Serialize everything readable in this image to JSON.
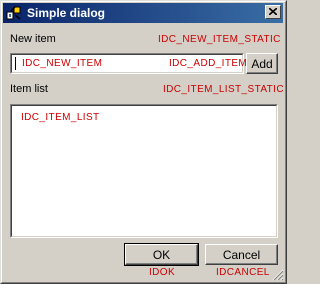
{
  "window": {
    "title": "Simple dialog"
  },
  "new_item": {
    "label": "New item",
    "id_label": "IDC_NEW_ITEM_STATIC"
  },
  "edit": {
    "id_label": "IDC_NEW_ITEM",
    "value": ""
  },
  "add_button": {
    "id_label": "IDC_ADD_ITEM",
    "label": "Add"
  },
  "item_list": {
    "label": "Item list",
    "id_label": "IDC_ITEM_LIST_STATIC",
    "list_id_label": "IDC_ITEM_LIST",
    "items": []
  },
  "ok_button": {
    "label": "OK",
    "id_label": "IDOK"
  },
  "cancel_button": {
    "label": "Cancel",
    "id_label": "IDCANCEL"
  },
  "colors": {
    "title_start": "#0a246a",
    "title_end": "#3a6ea5",
    "face": "#d4d0c8",
    "id_text": "#cc0000"
  },
  "icons": {
    "app": "app-icon",
    "close": "close-icon",
    "grip": "resize-grip-icon"
  }
}
